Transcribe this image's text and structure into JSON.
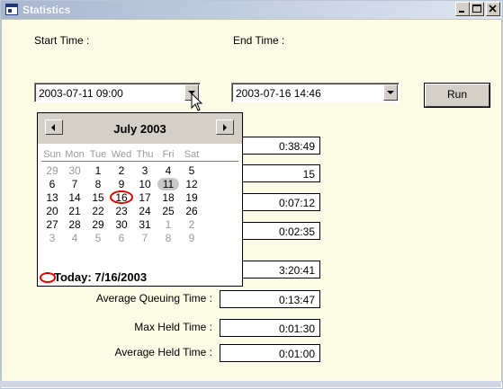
{
  "window": {
    "title": "Statistics"
  },
  "icons": {
    "app": "window-app-icon",
    "minimize": "minimize-icon",
    "maximize": "maximize-icon",
    "close": "close-icon",
    "cursor": "mouse-pointer-icon"
  },
  "colors": {
    "today_ring": "#e00000",
    "title_gradient_start": "#a7b6cf",
    "background": "#fbfbe6"
  },
  "start": {
    "label": "Start Time :",
    "value": "2003-07-11 09:00"
  },
  "end": {
    "label": "End Time :",
    "value": "2003-07-16 14:46"
  },
  "run_label": "Run",
  "calendar": {
    "month_title": "July 2003",
    "weekdays": [
      "Sun",
      "Mon",
      "Tue",
      "Wed",
      "Thu",
      "Fri",
      "Sat"
    ],
    "weeks": [
      [
        "29",
        "30",
        "1",
        "2",
        "3",
        "4",
        "5"
      ],
      [
        "6",
        "7",
        "8",
        "9",
        "10",
        "11",
        "12"
      ],
      [
        "13",
        "14",
        "15",
        "16",
        "17",
        "18",
        "19"
      ],
      [
        "20",
        "21",
        "22",
        "23",
        "24",
        "25",
        "26"
      ],
      [
        "27",
        "28",
        "29",
        "30",
        "31",
        "1",
        "2"
      ],
      [
        "3",
        "4",
        "5",
        "6",
        "7",
        "8",
        "9"
      ]
    ],
    "selected_day": "11",
    "today_day": "16",
    "today_text": "Today: 7/16/2003"
  },
  "stats": [
    {
      "label": "",
      "value": "0:38:49"
    },
    {
      "label": "",
      "value": "15"
    },
    {
      "label": "",
      "value": "0:07:12"
    },
    {
      "label": "",
      "value": "0:02:35"
    },
    {
      "label": "",
      "value": "3:20:41"
    },
    {
      "label": "Average Queuing Time :",
      "value": "0:13:47"
    },
    {
      "label": "Max Held Time :",
      "value": "0:01:30"
    },
    {
      "label": "Average Held Time :",
      "value": "0:01:00"
    }
  ]
}
